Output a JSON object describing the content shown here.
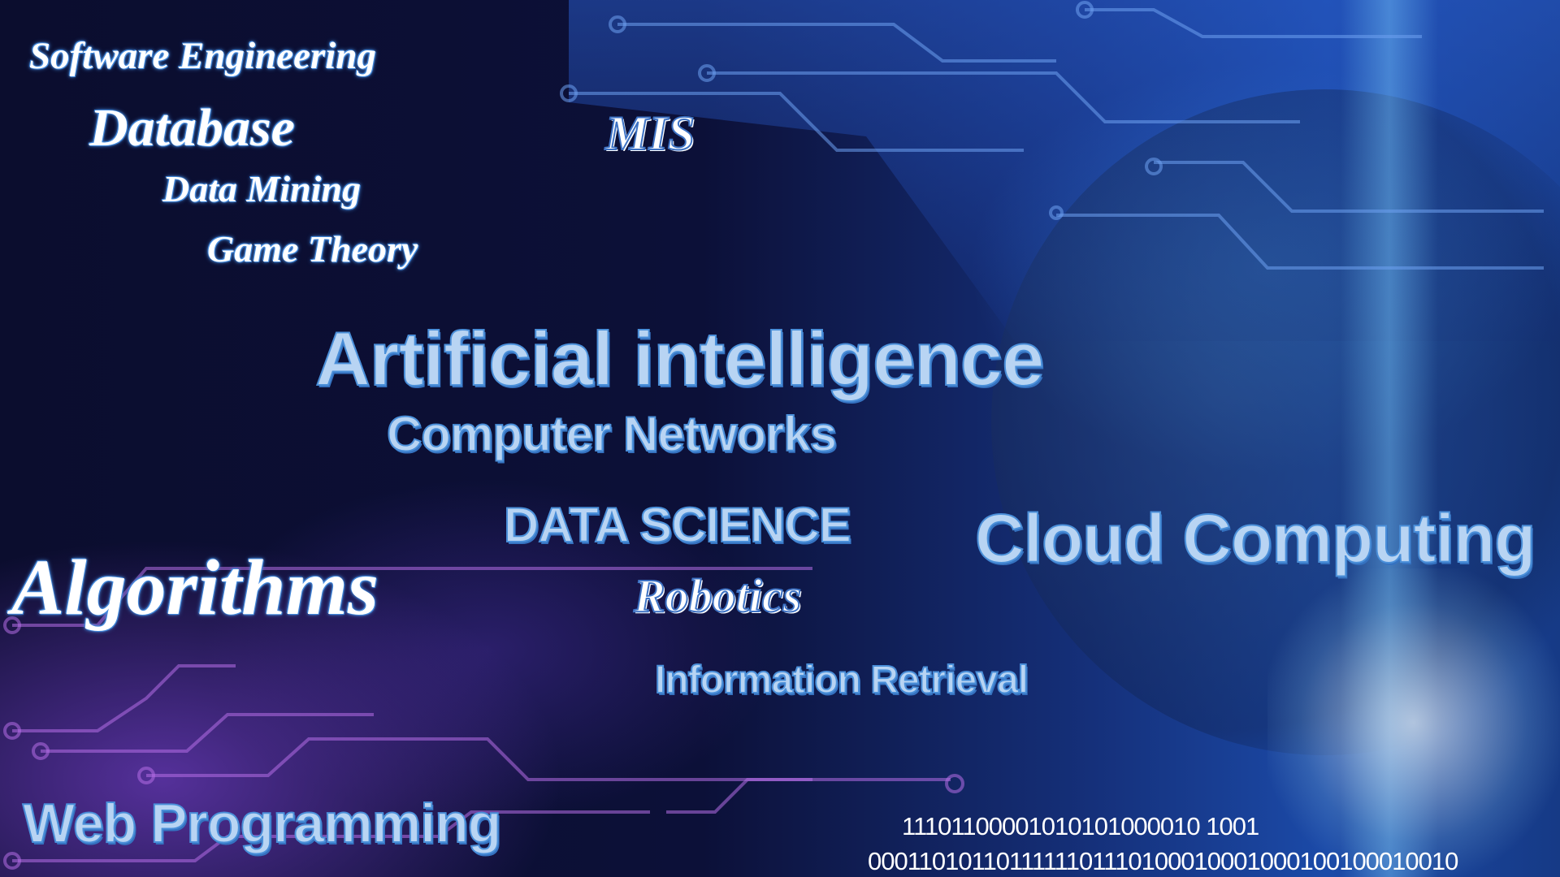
{
  "words": {
    "software_engineering": "Software Engineering",
    "database": "Database",
    "data_mining": "Data Mining",
    "game_theory": "Game Theory",
    "mis": "MIS",
    "artificial_intelligence": "Artificial intelligence",
    "computer_networks": "Computer Networks",
    "data_science": "DATA SCIENCE",
    "cloud_computing": "Cloud Computing",
    "algorithms": "Algorithms",
    "robotics": "Robotics",
    "information_retrieval": "Information Retrieval",
    "web_programming": "Web Programming"
  },
  "binary": {
    "line1": "11101100001010101000010 1001",
    "line2": "0001101011011111101110100010001000100100010010"
  },
  "colors": {
    "text_glow": "#4a90e2",
    "sans_fill": "#b8d4f3",
    "background_dark": "#0c0f33"
  }
}
